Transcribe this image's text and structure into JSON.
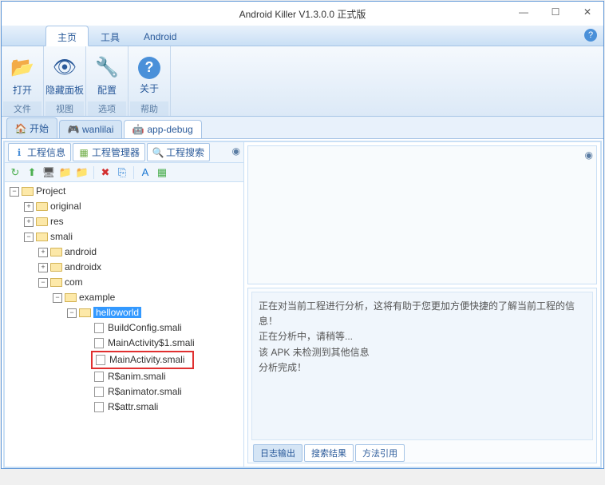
{
  "window": {
    "title": "Android Killer V1.3.0.0 正式版"
  },
  "menu": {
    "tabs": [
      "主页",
      "工具",
      "Android"
    ],
    "help": "?"
  },
  "ribbon": {
    "groups": [
      {
        "label": "文件",
        "buttons": [
          {
            "icon": "📂",
            "text": "打开"
          }
        ]
      },
      {
        "label": "视图",
        "buttons": [
          {
            "icon": "👁",
            "text": "隐藏面板"
          }
        ]
      },
      {
        "label": "选项",
        "buttons": [
          {
            "icon": "🔧",
            "text": "配置"
          }
        ]
      },
      {
        "label": "帮助",
        "buttons": [
          {
            "icon": "?",
            "text": "关于"
          }
        ]
      }
    ]
  },
  "docTabs": [
    {
      "icon": "🏠",
      "label": "开始",
      "color": "#4a90d9"
    },
    {
      "icon": "🎮",
      "label": "wanlilai",
      "color": "#c0504d"
    },
    {
      "icon": "🤖",
      "label": "app-debug",
      "color": "#70ad47",
      "active": true
    }
  ],
  "panelTabs": [
    {
      "icon": "ℹ",
      "label": "工程信息",
      "color": "#4a90d9"
    },
    {
      "icon": "▦",
      "label": "工程管理器",
      "color": "#70ad47"
    },
    {
      "icon": "🔍",
      "label": "工程搜索",
      "color": "#4a90d9"
    }
  ],
  "toolbar": {
    "icons": [
      "↻",
      "⬆",
      "🖥",
      "📁",
      "📁",
      "✖",
      "⎘",
      "A",
      "▦"
    ]
  },
  "tree": [
    {
      "depth": 0,
      "exp": "-",
      "type": "folder-open",
      "label": "Project"
    },
    {
      "depth": 1,
      "exp": "+",
      "type": "folder",
      "label": "original"
    },
    {
      "depth": 1,
      "exp": "+",
      "type": "folder",
      "label": "res"
    },
    {
      "depth": 1,
      "exp": "-",
      "type": "folder-open",
      "label": "smali"
    },
    {
      "depth": 2,
      "exp": "+",
      "type": "folder",
      "label": "android"
    },
    {
      "depth": 2,
      "exp": "+",
      "type": "folder",
      "label": "androidx"
    },
    {
      "depth": 2,
      "exp": "-",
      "type": "folder-open",
      "label": "com"
    },
    {
      "depth": 3,
      "exp": "-",
      "type": "folder-open",
      "label": "example"
    },
    {
      "depth": 4,
      "exp": "-",
      "type": "folder-open",
      "label": "helloworld",
      "selected": true
    },
    {
      "depth": 5,
      "exp": "",
      "type": "file",
      "label": "BuildConfig.smali"
    },
    {
      "depth": 5,
      "exp": "",
      "type": "file",
      "label": "MainActivity$1.smali"
    },
    {
      "depth": 5,
      "exp": "",
      "type": "file",
      "label": "MainActivity.smali",
      "highlighted": true
    },
    {
      "depth": 5,
      "exp": "",
      "type": "file",
      "label": "R$anim.smali"
    },
    {
      "depth": 5,
      "exp": "",
      "type": "file",
      "label": "R$animator.smali"
    },
    {
      "depth": 5,
      "exp": "",
      "type": "file",
      "label": "R$attr.smali"
    }
  ],
  "log": {
    "lines": [
      "正在对当前工程进行分析，这将有助于您更加方便快捷的了解当前工程的信息！",
      "正在分析中，请稍等...",
      "该 APK 未检测到其他信息",
      "分析完成！"
    ]
  },
  "bottomTabs": [
    "日志输出",
    "搜索结果",
    "方法引用"
  ]
}
